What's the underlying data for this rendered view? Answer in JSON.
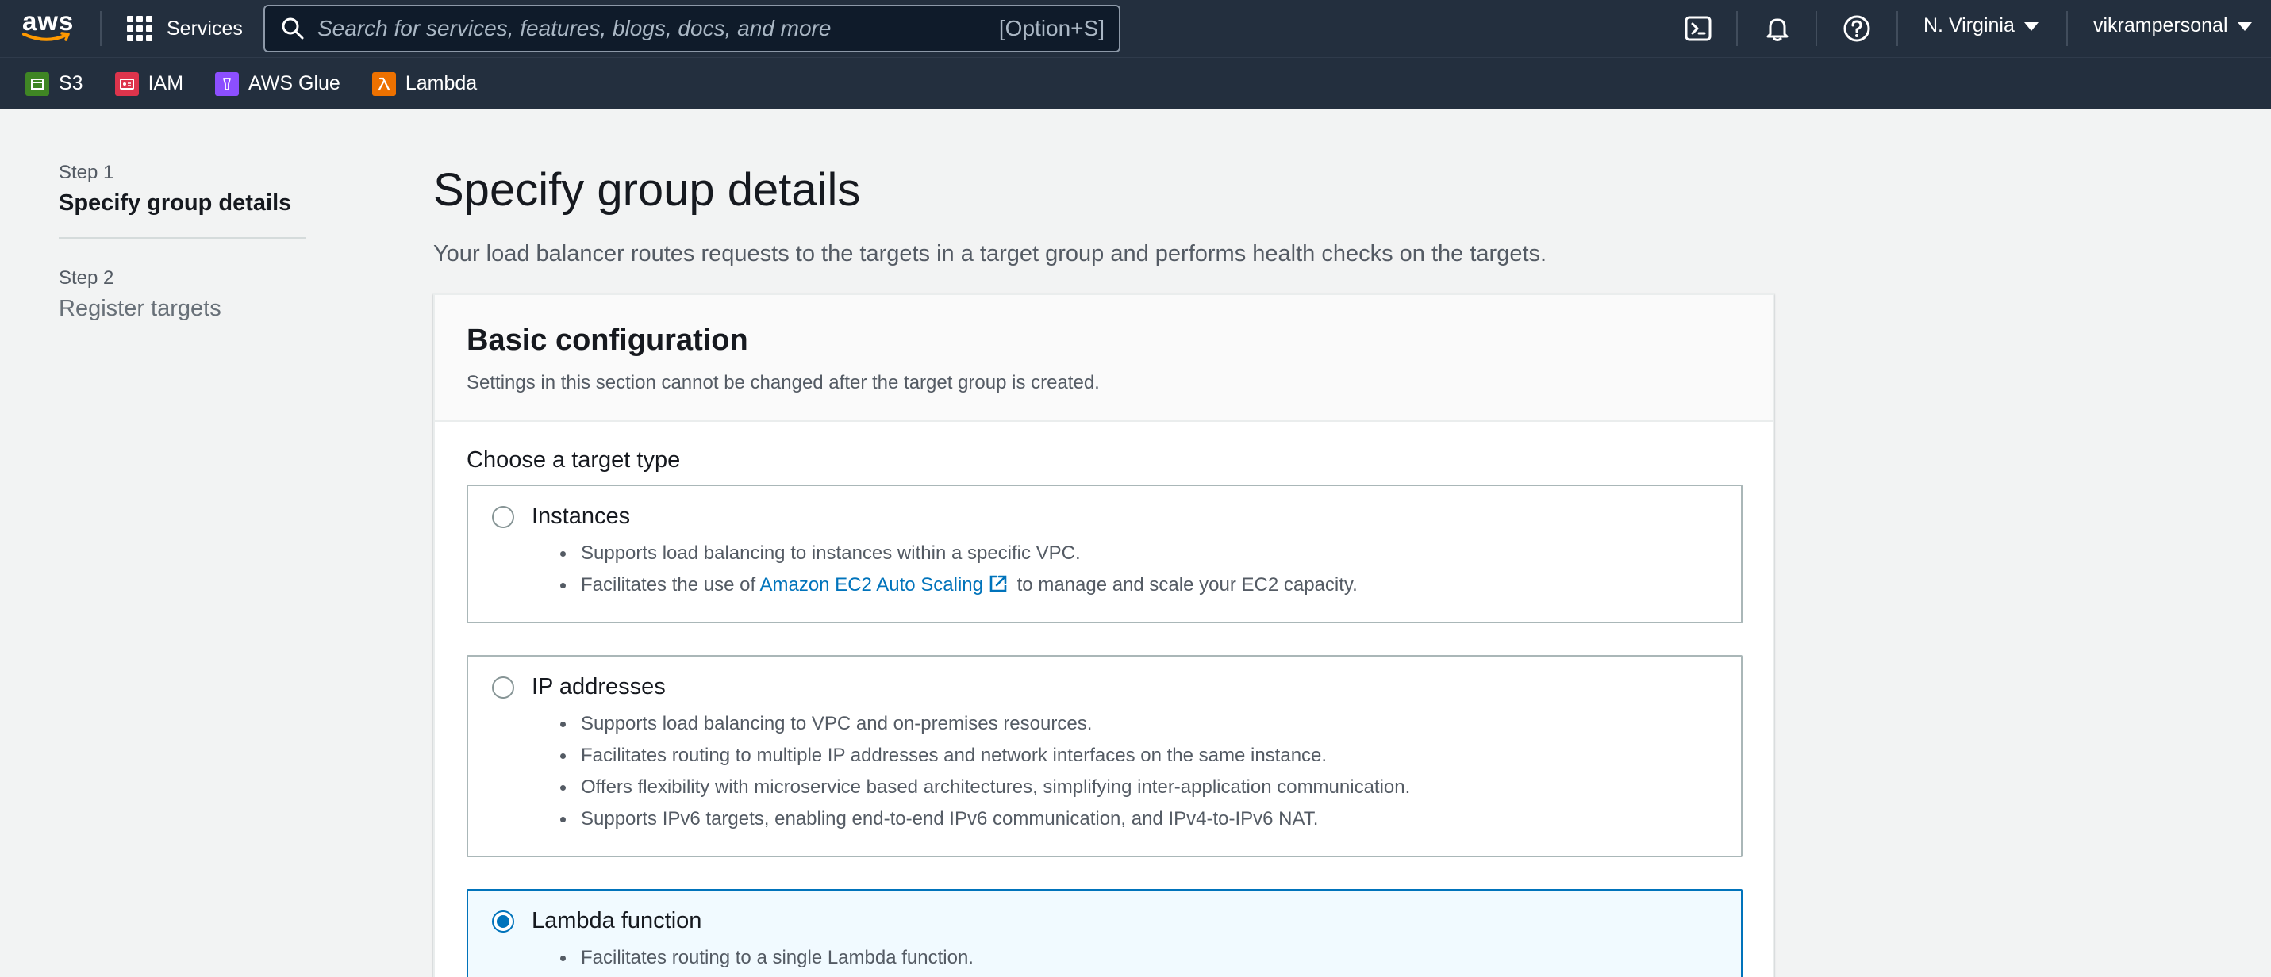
{
  "topnav": {
    "logo_text": "aws",
    "services_label": "Services",
    "search_placeholder": "Search for services, features, blogs, docs, and more",
    "search_shortcut": "[Option+S]",
    "region": "N. Virginia",
    "account": "vikrampersonal"
  },
  "favorites": [
    {
      "label": "S3",
      "icon": "s3-icon",
      "color": "#3f8624"
    },
    {
      "label": "IAM",
      "icon": "iam-icon",
      "color": "#dd344c"
    },
    {
      "label": "AWS Glue",
      "icon": "glue-icon",
      "color": "#8c4fff"
    },
    {
      "label": "Lambda",
      "icon": "lambda-icon",
      "color": "#ed7100"
    }
  ],
  "steps": {
    "step1_label": "Step 1",
    "step1_title": "Specify group details",
    "step2_label": "Step 2",
    "step2_title": "Register targets"
  },
  "page": {
    "title": "Specify group details",
    "description": "Your load balancer routes requests to the targets in a target group and performs health checks on the targets."
  },
  "basic_config": {
    "title": "Basic configuration",
    "subtitle": "Settings in this section cannot be changed after the target group is created.",
    "target_type_label": "Choose a target type",
    "options": [
      {
        "title": "Instances",
        "selected": false,
        "bullets": [
          "Supports load balancing to instances within a specific VPC.",
          "Facilitates the use of",
          "Amazon EC2 Auto Scaling",
          "to manage and scale your EC2 capacity."
        ]
      },
      {
        "title": "IP addresses",
        "selected": false,
        "bullets": [
          "Supports load balancing to VPC and on-premises resources.",
          "Facilitates routing to multiple IP addresses and network interfaces on the same instance.",
          "Offers flexibility with microservice based architectures, simplifying inter-application communication.",
          "Supports IPv6 targets, enabling end-to-end IPv6 communication, and IPv4-to-IPv6 NAT."
        ]
      },
      {
        "title": "Lambda function",
        "selected": true,
        "bullets": [
          "Facilitates routing to a single Lambda function."
        ]
      }
    ]
  },
  "colors": {
    "nav_bg": "#232f3e",
    "accent": "#0073bb",
    "page_bg": "#f2f3f3"
  }
}
